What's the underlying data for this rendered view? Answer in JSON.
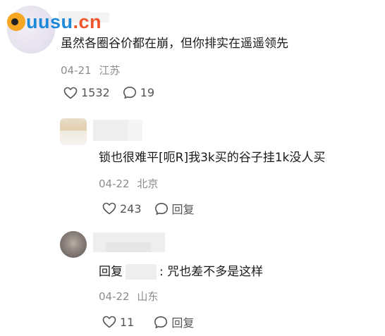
{
  "brand": {
    "logo_part1": "uusu",
    "logo_part2": ".cn",
    "accent_blue": "#1e88d9",
    "accent_orange": "#f0562d"
  },
  "icons": {
    "like": "heart-outline-icon",
    "comment": "speech-bubble-icon"
  },
  "main_comment": {
    "text": "虽然各圈谷价都在崩，但你排实在遥遥领先",
    "date": "04-21",
    "location": "江苏",
    "likes": "1532",
    "comments": "19"
  },
  "replies": [
    {
      "text": "锁也很难平[呃R]我3k买的谷子挂1k没人买",
      "date": "04-22",
      "location": "北京",
      "likes": "243",
      "reply_label": "回复"
    },
    {
      "reply_prefix": "回复",
      "text": ": 咒也差不多是这样",
      "date": "04-22",
      "location": "山东",
      "likes": "11",
      "reply_label": "回复"
    }
  ]
}
